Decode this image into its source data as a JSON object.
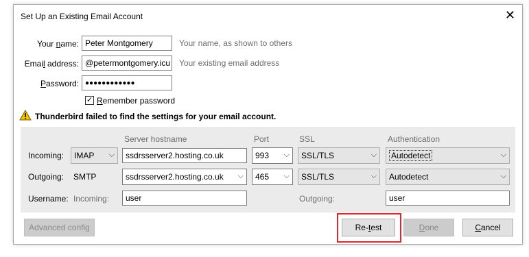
{
  "window": {
    "title": "Set Up an Existing Email Account",
    "close_glyph": "✕"
  },
  "identity": {
    "name_label_pre": "Your ",
    "name_label_u": "n",
    "name_label_post": "ame:",
    "name_value": "Peter Montgomery",
    "name_hint": "Your name, as shown to others",
    "email_label_pre": "Emai",
    "email_label_u": "l",
    "email_label_post": " address:",
    "email_value": "@petermontgomery.icu",
    "email_hint": "Your existing email address",
    "password_label_pre": "",
    "password_label_u": "P",
    "password_label_post": "assword:",
    "password_value": "●●●●●●●●●●●●",
    "remember_check": "✓",
    "remember_label_u": "R",
    "remember_label_post": "emember password"
  },
  "warning": {
    "icon": "warning-icon",
    "text": "Thunderbird failed to find the settings for your email account."
  },
  "server": {
    "headers": {
      "hostname": "Server hostname",
      "port": "Port",
      "ssl": "SSL",
      "auth": "Authentication"
    },
    "incoming": {
      "label": "Incoming:",
      "protocol": "IMAP",
      "hostname": "ssdrsserver2.hosting.co.uk",
      "port": "993",
      "ssl": "SSL/TLS",
      "auth": "Autodetect"
    },
    "outgoing": {
      "label": "Outgoing:",
      "protocol": "SMTP",
      "hostname": "ssdrsserver2.hosting.co.uk",
      "port": "465",
      "ssl": "SSL/TLS",
      "auth": "Autodetect"
    },
    "username": {
      "label": "Username:",
      "incoming_label": "Incoming:",
      "incoming_value": "user",
      "outgoing_label": "Outgoing:",
      "outgoing_value": "user"
    },
    "chevron": "⌵"
  },
  "buttons": {
    "advanced": "Advanced config",
    "retest_pre": "Re-",
    "retest_u": "t",
    "retest_post": "est",
    "done_u": "D",
    "done_post": "one",
    "cancel_u": "C",
    "cancel_post": "ancel"
  },
  "colors": {
    "highlight": "#e0262a",
    "warning": "#f2c200"
  }
}
